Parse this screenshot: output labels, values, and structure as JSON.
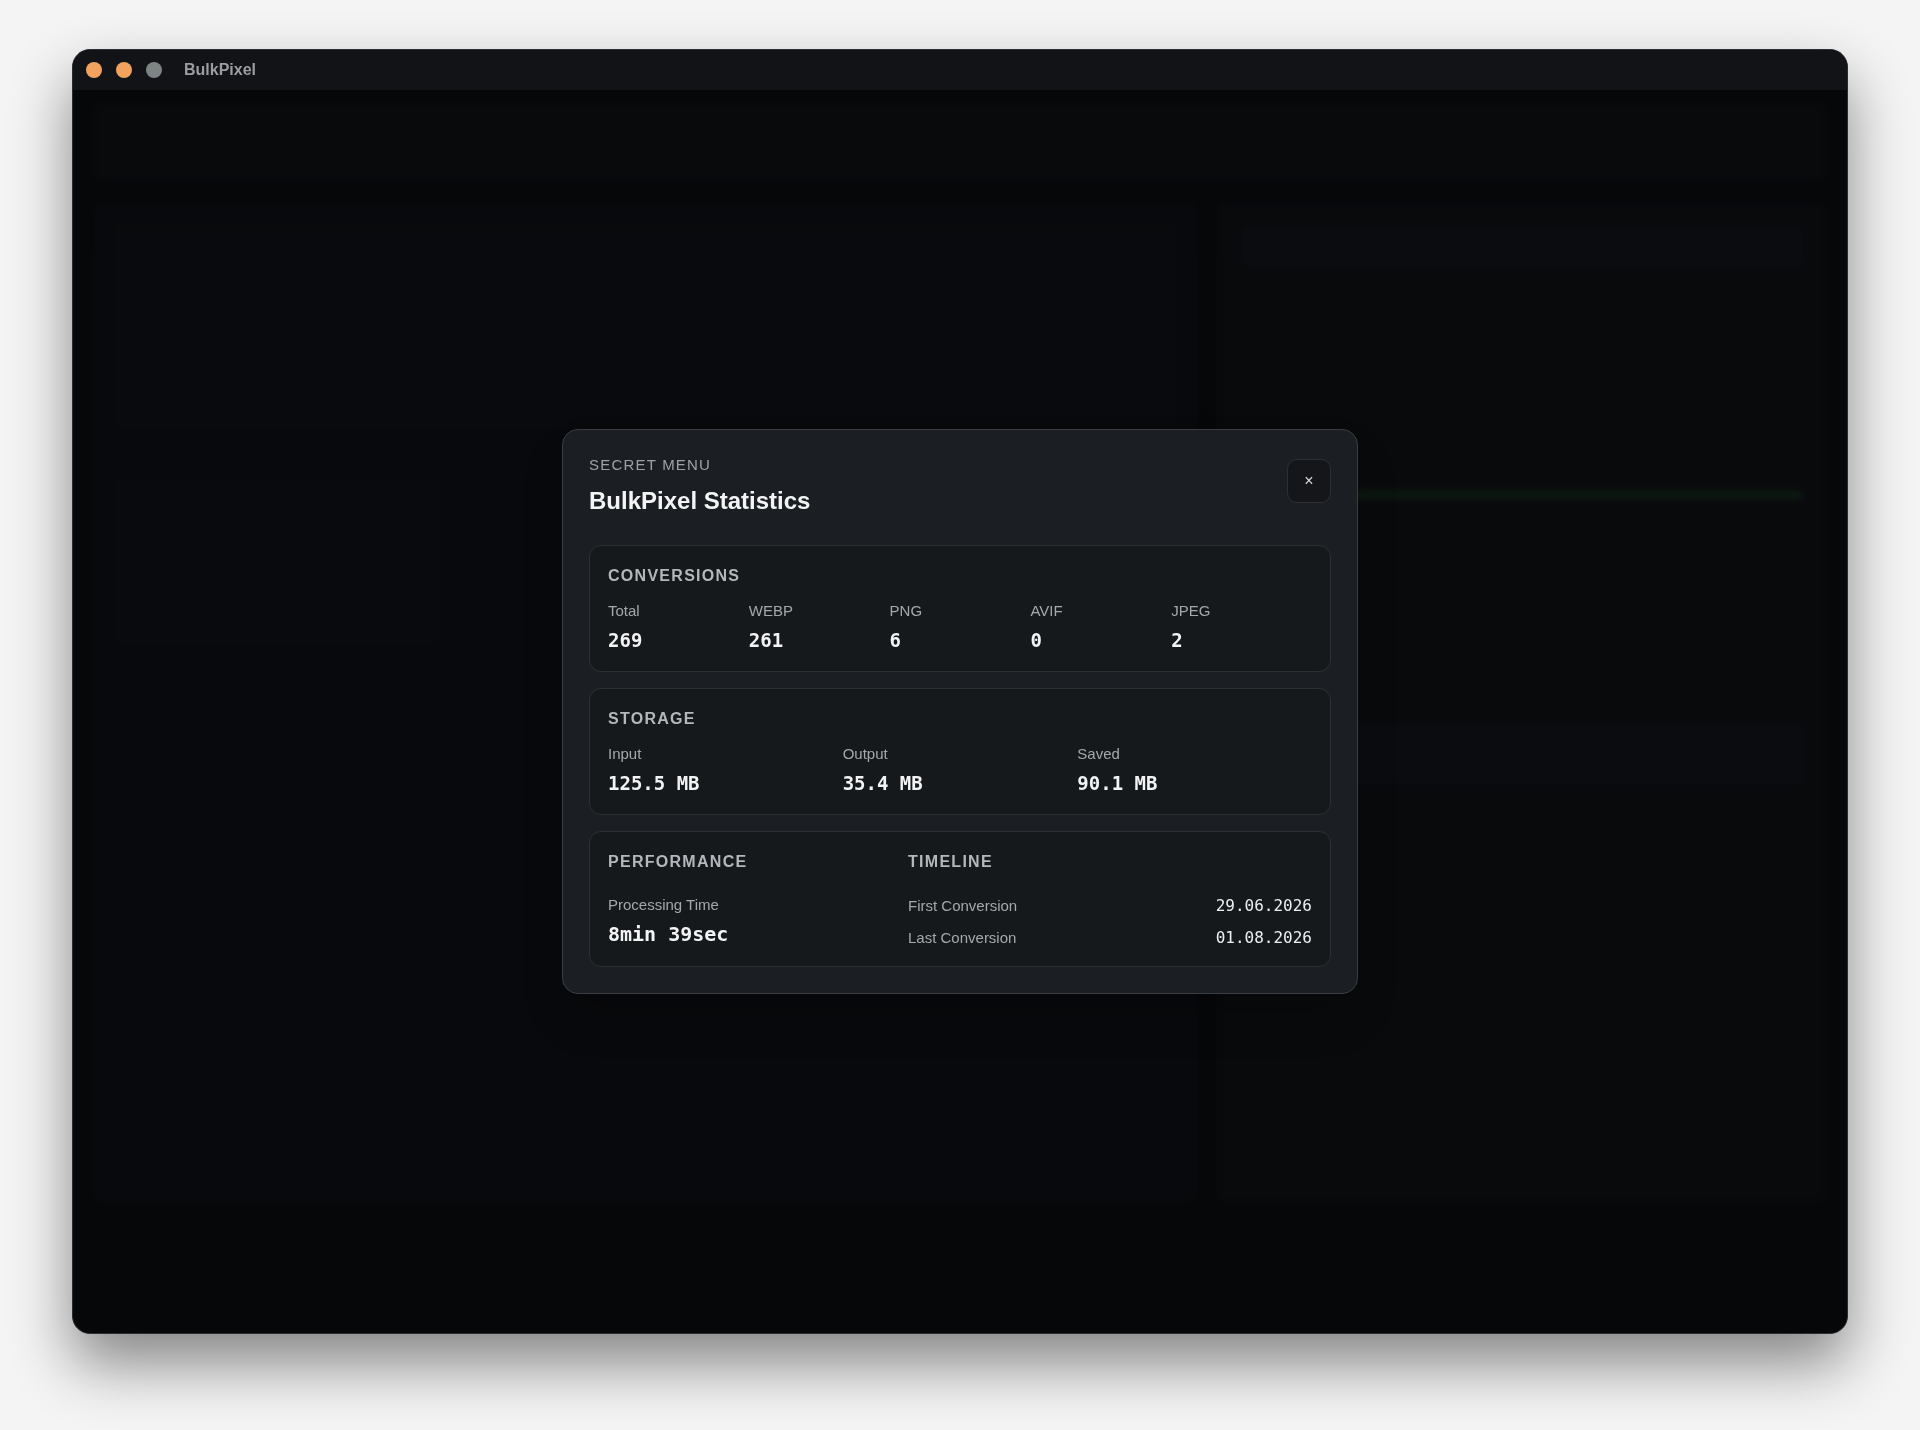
{
  "window": {
    "title": "BulkPixel",
    "controls": [
      {
        "color": "#f0a25e"
      },
      {
        "color": "#f0a25e"
      },
      {
        "color": "#7d8483"
      }
    ]
  },
  "dialog": {
    "eyebrow": "SECRET MENU",
    "title": "BulkPixel Statistics",
    "close": "×",
    "conversions": {
      "heading": "CONVERSIONS",
      "stats": [
        {
          "label": "Total",
          "value": "269"
        },
        {
          "label": "WEBP",
          "value": "261"
        },
        {
          "label": "PNG",
          "value": "6"
        },
        {
          "label": "AVIF",
          "value": "0"
        },
        {
          "label": "JPEG",
          "value": "2"
        }
      ]
    },
    "storage": {
      "heading": "STORAGE",
      "stats": [
        {
          "label": "Input",
          "value": "125.5 MB"
        },
        {
          "label": "Output",
          "value": "35.4 MB"
        },
        {
          "label": "Saved",
          "value": "90.1 MB"
        }
      ]
    },
    "performance": {
      "heading": "PERFORMANCE",
      "label": "Processing Time",
      "value": "8min 39sec"
    },
    "timeline": {
      "heading": "TIMELINE",
      "rows": [
        {
          "label": "First Conversion",
          "value": "29.06.2026"
        },
        {
          "label": "Last Conversion",
          "value": "01.08.2026"
        }
      ]
    }
  }
}
